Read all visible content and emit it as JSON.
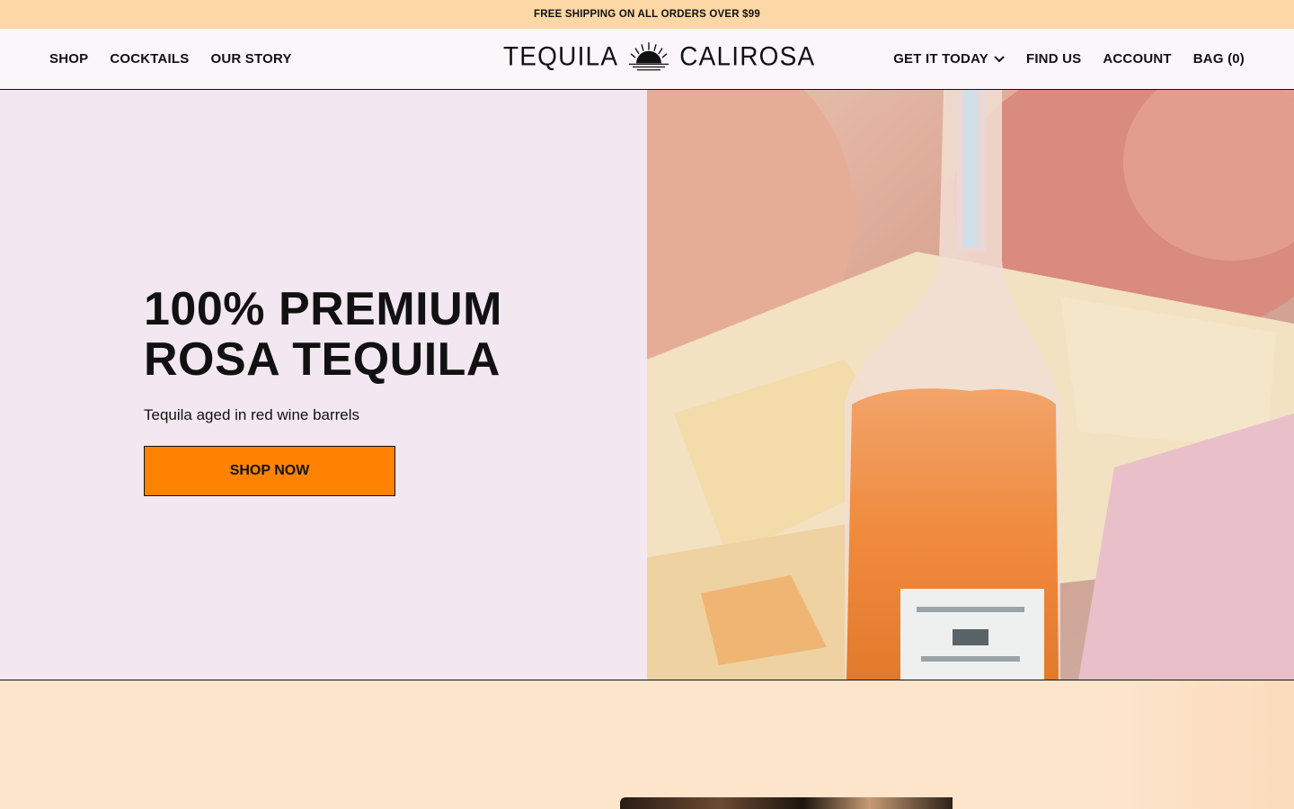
{
  "promo": {
    "text": "FREE SHIPPING ON ALL ORDERS OVER $99"
  },
  "nav_left": [
    {
      "label": "SHOP"
    },
    {
      "label": "COCKTAILS"
    },
    {
      "label": "OUR STORY"
    }
  ],
  "logo": {
    "left": "TEQUILA",
    "right": "CALIROSA",
    "icon": "sunrise-icon"
  },
  "nav_right": {
    "get_it_today": "GET IT TODAY",
    "find_us": "FIND US",
    "account": "ACCOUNT",
    "bag": "BAG (0)"
  },
  "hero": {
    "title_line1": "100% PREMIUM",
    "title_line2": "ROSA TEQUILA",
    "subtitle": "Tequila aged in red wine barrels",
    "cta": "SHOP NOW"
  },
  "colors": {
    "promo_bg": "#fdd7a6",
    "hero_left_bg": "#f3e8f1",
    "cta_bg": "#ff8300",
    "section_bg": "#fde5cc"
  }
}
